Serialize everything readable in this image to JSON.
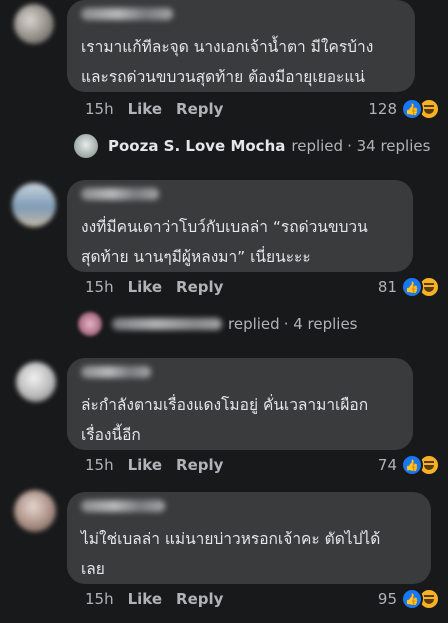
{
  "comments": [
    {
      "text": "เรามาแก้ทีละจุด นางเอกเจ้าน้ำตา มีใครบ้าง\nและรถด่วนขบวนสุดท้าย ต้องมีอายุเยอะแน่",
      "time": "15h",
      "like": "Like",
      "reply": "Reply",
      "reactions": "128"
    },
    {
      "text": "งงที่มีคนเดาว่าโบว์กับเบลล่า “รถด่วนขบวน\nสุดท้าย นานๆมีผู้หลงมา” เนี่ยนะะะ",
      "time": "15h",
      "like": "Like",
      "reply": "Reply",
      "reactions": "81"
    },
    {
      "text": "ล่ะกำลังตามเรื่องแดงโมอยู่ คั่นเวลามาเผือก\nเรื่องนี้อีก",
      "time": "15h",
      "like": "Like",
      "reply": "Reply",
      "reactions": "74"
    },
    {
      "text": "ไม่ใช่เบลล่า แม่นายบ่าวหรอกเจ้าคะ  ตัดไปได้\nเลย",
      "time": "15h",
      "like": "Like",
      "reply": "Reply",
      "reactions": "95"
    }
  ],
  "replies": [
    {
      "name": "Pooza S. Love Mocha",
      "action": "replied",
      "count": "· 34 replies"
    },
    {
      "name": "",
      "action": "replied",
      "count": "· 4 replies"
    }
  ],
  "colors": {
    "background": "#18191a",
    "bubble": "#3a3b3c",
    "text": "#e4e6eb",
    "meta": "#b0b3b8",
    "like_blue": "#1877f2",
    "haha_yellow": "#f7b125"
  },
  "icons": [
    "like-reaction-icon",
    "haha-reaction-icon"
  ]
}
